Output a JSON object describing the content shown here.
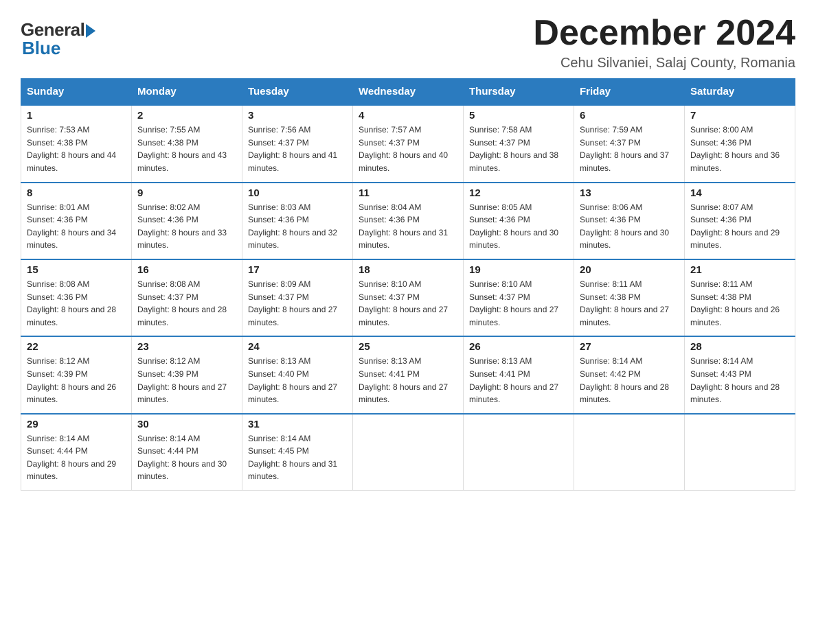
{
  "logo": {
    "general": "General",
    "blue": "Blue"
  },
  "title": "December 2024",
  "location": "Cehu Silvaniei, Salaj County, Romania",
  "days_of_week": [
    "Sunday",
    "Monday",
    "Tuesday",
    "Wednesday",
    "Thursday",
    "Friday",
    "Saturday"
  ],
  "weeks": [
    [
      {
        "day": "1",
        "sunrise": "7:53 AM",
        "sunset": "4:38 PM",
        "daylight": "8 hours and 44 minutes."
      },
      {
        "day": "2",
        "sunrise": "7:55 AM",
        "sunset": "4:38 PM",
        "daylight": "8 hours and 43 minutes."
      },
      {
        "day": "3",
        "sunrise": "7:56 AM",
        "sunset": "4:37 PM",
        "daylight": "8 hours and 41 minutes."
      },
      {
        "day": "4",
        "sunrise": "7:57 AM",
        "sunset": "4:37 PM",
        "daylight": "8 hours and 40 minutes."
      },
      {
        "day": "5",
        "sunrise": "7:58 AM",
        "sunset": "4:37 PM",
        "daylight": "8 hours and 38 minutes."
      },
      {
        "day": "6",
        "sunrise": "7:59 AM",
        "sunset": "4:37 PM",
        "daylight": "8 hours and 37 minutes."
      },
      {
        "day": "7",
        "sunrise": "8:00 AM",
        "sunset": "4:36 PM",
        "daylight": "8 hours and 36 minutes."
      }
    ],
    [
      {
        "day": "8",
        "sunrise": "8:01 AM",
        "sunset": "4:36 PM",
        "daylight": "8 hours and 34 minutes."
      },
      {
        "day": "9",
        "sunrise": "8:02 AM",
        "sunset": "4:36 PM",
        "daylight": "8 hours and 33 minutes."
      },
      {
        "day": "10",
        "sunrise": "8:03 AM",
        "sunset": "4:36 PM",
        "daylight": "8 hours and 32 minutes."
      },
      {
        "day": "11",
        "sunrise": "8:04 AM",
        "sunset": "4:36 PM",
        "daylight": "8 hours and 31 minutes."
      },
      {
        "day": "12",
        "sunrise": "8:05 AM",
        "sunset": "4:36 PM",
        "daylight": "8 hours and 30 minutes."
      },
      {
        "day": "13",
        "sunrise": "8:06 AM",
        "sunset": "4:36 PM",
        "daylight": "8 hours and 30 minutes."
      },
      {
        "day": "14",
        "sunrise": "8:07 AM",
        "sunset": "4:36 PM",
        "daylight": "8 hours and 29 minutes."
      }
    ],
    [
      {
        "day": "15",
        "sunrise": "8:08 AM",
        "sunset": "4:36 PM",
        "daylight": "8 hours and 28 minutes."
      },
      {
        "day": "16",
        "sunrise": "8:08 AM",
        "sunset": "4:37 PM",
        "daylight": "8 hours and 28 minutes."
      },
      {
        "day": "17",
        "sunrise": "8:09 AM",
        "sunset": "4:37 PM",
        "daylight": "8 hours and 27 minutes."
      },
      {
        "day": "18",
        "sunrise": "8:10 AM",
        "sunset": "4:37 PM",
        "daylight": "8 hours and 27 minutes."
      },
      {
        "day": "19",
        "sunrise": "8:10 AM",
        "sunset": "4:37 PM",
        "daylight": "8 hours and 27 minutes."
      },
      {
        "day": "20",
        "sunrise": "8:11 AM",
        "sunset": "4:38 PM",
        "daylight": "8 hours and 27 minutes."
      },
      {
        "day": "21",
        "sunrise": "8:11 AM",
        "sunset": "4:38 PM",
        "daylight": "8 hours and 26 minutes."
      }
    ],
    [
      {
        "day": "22",
        "sunrise": "8:12 AM",
        "sunset": "4:39 PM",
        "daylight": "8 hours and 26 minutes."
      },
      {
        "day": "23",
        "sunrise": "8:12 AM",
        "sunset": "4:39 PM",
        "daylight": "8 hours and 27 minutes."
      },
      {
        "day": "24",
        "sunrise": "8:13 AM",
        "sunset": "4:40 PM",
        "daylight": "8 hours and 27 minutes."
      },
      {
        "day": "25",
        "sunrise": "8:13 AM",
        "sunset": "4:41 PM",
        "daylight": "8 hours and 27 minutes."
      },
      {
        "day": "26",
        "sunrise": "8:13 AM",
        "sunset": "4:41 PM",
        "daylight": "8 hours and 27 minutes."
      },
      {
        "day": "27",
        "sunrise": "8:14 AM",
        "sunset": "4:42 PM",
        "daylight": "8 hours and 28 minutes."
      },
      {
        "day": "28",
        "sunrise": "8:14 AM",
        "sunset": "4:43 PM",
        "daylight": "8 hours and 28 minutes."
      }
    ],
    [
      {
        "day": "29",
        "sunrise": "8:14 AM",
        "sunset": "4:44 PM",
        "daylight": "8 hours and 29 minutes."
      },
      {
        "day": "30",
        "sunrise": "8:14 AM",
        "sunset": "4:44 PM",
        "daylight": "8 hours and 30 minutes."
      },
      {
        "day": "31",
        "sunrise": "8:14 AM",
        "sunset": "4:45 PM",
        "daylight": "8 hours and 31 minutes."
      },
      null,
      null,
      null,
      null
    ]
  ]
}
